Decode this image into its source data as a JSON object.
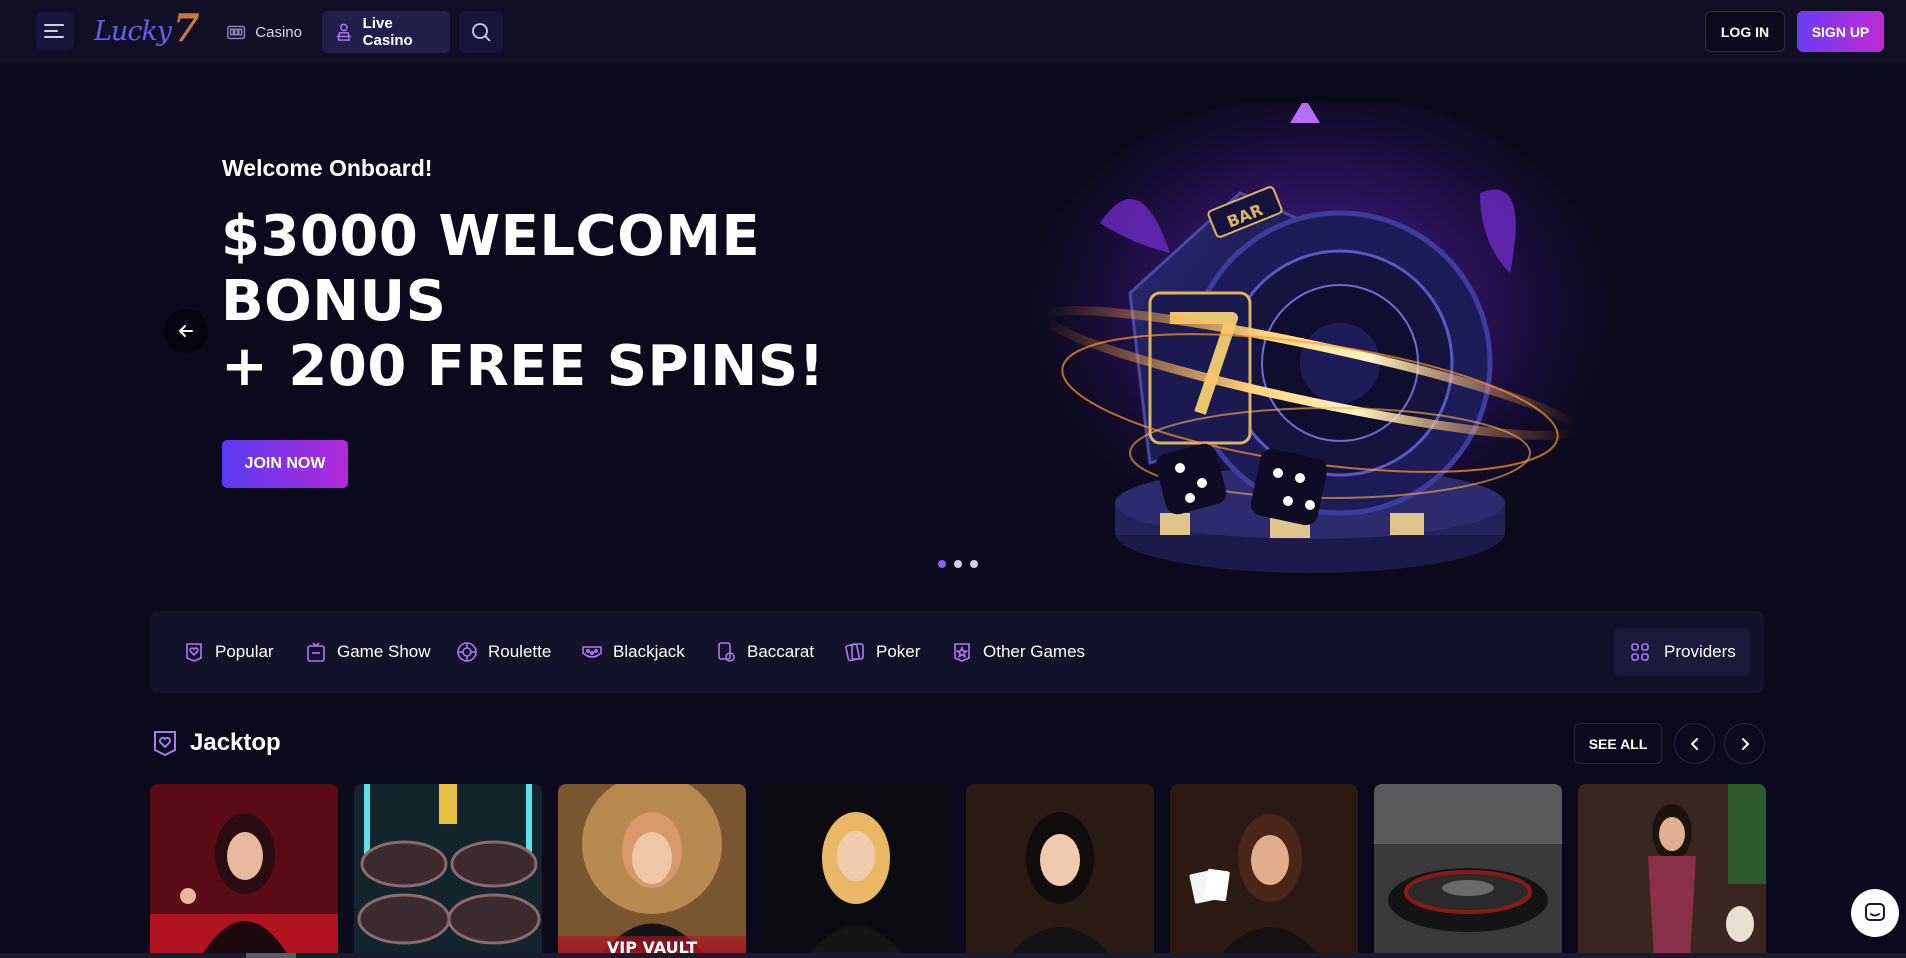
{
  "header": {
    "menu_icon": "hamburger-icon",
    "logo_text": "Lucky",
    "logo_number": "7",
    "nav": [
      {
        "label": "Casino",
        "icon": "slot-machine-icon"
      },
      {
        "label": "Live Casino",
        "icon": "dealer-icon"
      }
    ],
    "search_icon": "search-icon",
    "login_label": "LOG IN",
    "signup_label": "SIGN UP"
  },
  "hero": {
    "subtitle": "Welcome Onboard!",
    "title_lines": [
      "$3000 WELCOME",
      "BONUS",
      "+ 200 FREE SPINS!"
    ],
    "cta_label": "JOIN NOW",
    "art_label": "BAR",
    "slides": 3,
    "active_slide": 1
  },
  "categories": [
    {
      "label": "Popular",
      "icon": "heart-badge-icon"
    },
    {
      "label": "Game Show",
      "icon": "tv-icon"
    },
    {
      "label": "Roulette",
      "icon": "roulette-icon"
    },
    {
      "label": "Blackjack",
      "icon": "cards-icon"
    },
    {
      "label": "Baccarat",
      "icon": "baccarat-icon"
    },
    {
      "label": "Poker",
      "icon": "poker-icon"
    },
    {
      "label": "Other Games",
      "icon": "star-badge-icon"
    }
  ],
  "providers_label": "Providers",
  "section": {
    "title": "Jacktop",
    "see_all_label": "SEE ALL"
  },
  "cards": [
    {
      "id": "dealer-1"
    },
    {
      "id": "roulette-tables"
    },
    {
      "id": "vip-vault",
      "label": "VIP VAULT"
    },
    {
      "id": "dealer-2"
    },
    {
      "id": "dealer-3"
    },
    {
      "id": "dealer-4"
    },
    {
      "id": "roulette-wheel"
    },
    {
      "id": "dealer-5"
    }
  ],
  "colors": {
    "background": "#0b0a1c",
    "topbar": "#100f26",
    "accent_start": "#6a3cf5",
    "accent_end": "#c02bd6",
    "category_bar": "#13122b",
    "icon_purple": "#a77bf0"
  }
}
